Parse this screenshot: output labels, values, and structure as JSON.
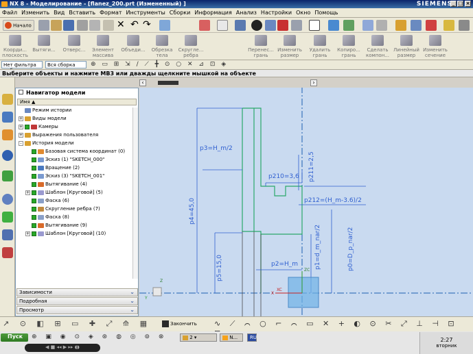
{
  "window": {
    "title": "NX 8 - Моделирование - [flanez_200.prt (Измененный) ]",
    "brand": "SIEMENS"
  },
  "menu": [
    "Файл",
    "Изменить",
    "Вид",
    "Вставить",
    "Формат",
    "Инструменты",
    "Сборки",
    "Информация",
    "Анализ",
    "Настройки",
    "Окно",
    "Помощь"
  ],
  "toolbar": {
    "start_label": "Начало"
  },
  "ribbon": [
    {
      "label": "Коорди... плоскость"
    },
    {
      "label": "Вытяги..."
    },
    {
      "label": "Отверс..."
    },
    {
      "label": "Элемент массива"
    },
    {
      "label": "Объеди..."
    },
    {
      "label": "Обрезка тела"
    },
    {
      "label": "Скругле... ребра"
    },
    {
      "label": "Перенес... грань"
    },
    {
      "label": "Изменить размер"
    },
    {
      "label": "Удалить грань"
    },
    {
      "label": "Копиро... грань"
    },
    {
      "label": "Сделать компон..."
    },
    {
      "label": "Линейный размер"
    },
    {
      "label": "Изменить сечение"
    }
  ],
  "filter": {
    "type_filter": "Нет фильтра выб",
    "assembly_filter": "Вся сборка"
  },
  "status": "Выберите объекты и нажмите MB3 или дважды щелкните мышкой на объекте",
  "navigator": {
    "title": "Навигатор модели",
    "col_name": "Имя",
    "items": [
      {
        "label": "Режим истории",
        "level": 0,
        "check": false,
        "expand": ""
      },
      {
        "label": "Виды модели",
        "level": 0,
        "check": false,
        "expand": "+"
      },
      {
        "label": "Камеры",
        "level": 0,
        "check": true,
        "expand": "+"
      },
      {
        "label": "Выражения пользователя",
        "level": 0,
        "check": false,
        "expand": "+"
      },
      {
        "label": "История модели",
        "level": 0,
        "check": false,
        "expand": "-"
      },
      {
        "label": "Базовая система координат (0)",
        "level": 1,
        "check": true,
        "expand": ""
      },
      {
        "label": "Эскиз (1) \"SKETCH_000\"",
        "level": 1,
        "check": true,
        "expand": ""
      },
      {
        "label": "Вращение (2)",
        "level": 1,
        "check": true,
        "expand": ""
      },
      {
        "label": "Эскиз (3) \"SKETCH_001\"",
        "level": 1,
        "check": true,
        "expand": ""
      },
      {
        "label": "Вытягивание (4)",
        "level": 1,
        "check": true,
        "expand": ""
      },
      {
        "label": "Шаблон [Круговой] (5)",
        "level": 1,
        "check": true,
        "expand": "+"
      },
      {
        "label": "Фаска (6)",
        "level": 1,
        "check": true,
        "expand": ""
      },
      {
        "label": "Скругление ребра (7)",
        "level": 1,
        "check": true,
        "expand": ""
      },
      {
        "label": "Фаска (8)",
        "level": 1,
        "check": true,
        "expand": ""
      },
      {
        "label": "Вытягивание (9)",
        "level": 1,
        "check": true,
        "expand": ""
      },
      {
        "label": "Шаблон [Круговой] (10)",
        "level": 1,
        "check": true,
        "expand": "+"
      }
    ],
    "accordions": [
      "Зависимости",
      "Подробная",
      "Просмотр"
    ]
  },
  "sketch": {
    "dimensions": [
      "p3=H_m/2",
      "p4=45,0",
      "p5=15,0",
      "p2=H_m",
      "p210=3,6",
      "p211=2,5",
      "p212=(H_m-3.6)/2",
      "p1=d_m_nar/2",
      "p0=D_p_nar/2"
    ],
    "axis_labels": [
      "ZC",
      "XC",
      "Y",
      "X",
      "Z"
    ]
  },
  "bottom_toolbar": {
    "finish_sketch": "Закончить эскиз"
  },
  "taskbar": {
    "start": "Пуск",
    "lang": "RU",
    "time": "2:27",
    "day": "вторник",
    "task_count": "2"
  }
}
